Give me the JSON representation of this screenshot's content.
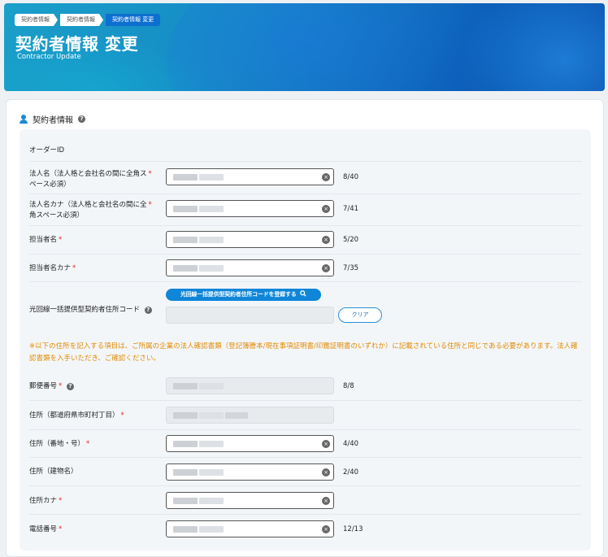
{
  "breadcrumb": [
    "契約者情報",
    "契約者情報",
    "契約者情報 変更"
  ],
  "page": {
    "title": "契約者情報 変更",
    "subtitle": "Contractor Update"
  },
  "section": {
    "title": "契約者情報"
  },
  "fields": {
    "order_id": {
      "label": "オーダーID"
    },
    "corp_name": {
      "label_l1": "法人名（法人格と会社名の間に全角ス",
      "label_l2": "ペース必須）",
      "count": "8/40"
    },
    "corp_kana": {
      "label_l1": "法人名カナ（法人格と会社名の間に全",
      "label_l2": "角スペース必須）",
      "count": "7/41"
    },
    "person": {
      "label": "担当者名",
      "count": "5/20"
    },
    "person_kana": {
      "label": "担当者名カナ",
      "count": "7/35"
    },
    "address_code": {
      "label": "光回線一括提供型契約者住所コード",
      "register_button": "光回線一括提供型契約者住所コードを登録する",
      "clear_button": "クリア"
    },
    "postal": {
      "label": "郵便番号",
      "count": "8/8"
    },
    "pref": {
      "label": "住所（都道府県市町村丁目）"
    },
    "street": {
      "label": "住所（番地・号）",
      "count": "4/40"
    },
    "building": {
      "label": "住所（建物名）",
      "count": "2/40"
    },
    "addr_kana": {
      "label": "住所カナ"
    },
    "phone": {
      "label": "電話番号",
      "count": "12/13"
    }
  },
  "notice": "※以下の住所を記入する項目は、ご所属の企業の法人確認書類（登記簿謄本/現在事項証明書/印鑑証明書のいずれか）に記載されている住所と同じである必要があります。法人確認書類を入手いただき、ご確認ください。",
  "required_mark": "*",
  "colors": {
    "accent": "#0f86d8",
    "required": "#e02424",
    "notice": "#e08a00"
  }
}
